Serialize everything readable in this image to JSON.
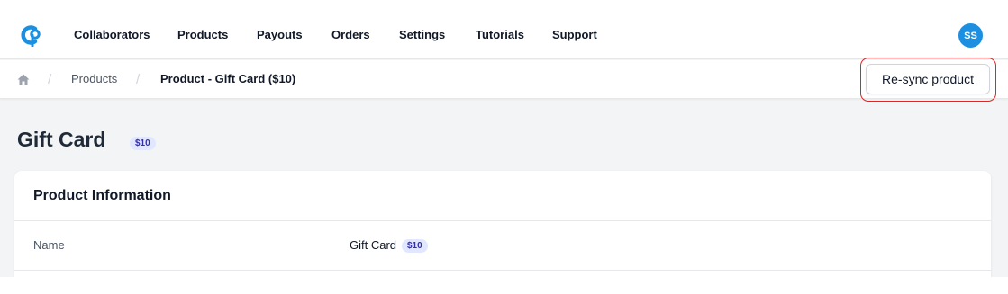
{
  "nav": {
    "logo_icon": "cp-logo-icon",
    "items": [
      "Collaborators",
      "Products",
      "Payouts",
      "Orders",
      "Settings",
      "Tutorials",
      "Support"
    ],
    "avatar_initials": "SS"
  },
  "breadcrumb": {
    "home_icon": "home-icon",
    "separator": "/",
    "products": "Products",
    "current": "Product - Gift Card ($10)"
  },
  "actions": {
    "resync_label": "Re-sync product"
  },
  "page": {
    "title": "Gift Card",
    "price_badge": "$10"
  },
  "card": {
    "title": "Product Information",
    "rows": [
      {
        "label": "Name",
        "value": "Gift Card",
        "badge": "$10"
      }
    ]
  },
  "colors": {
    "accent": "#1d8fe0",
    "badge_bg": "#e0e7ff",
    "highlight": "#dc2626"
  }
}
